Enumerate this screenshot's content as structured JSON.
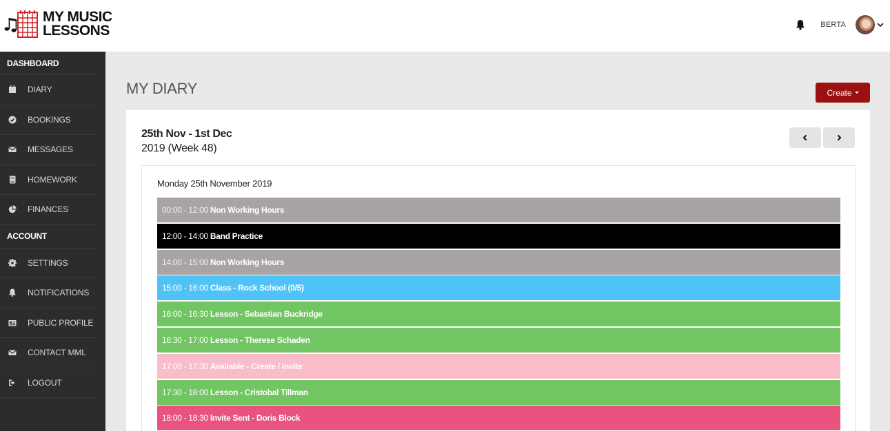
{
  "brand": {
    "line1": "MY MUSIC",
    "line2": "LESSONS"
  },
  "header": {
    "username": "BERTA"
  },
  "sidebar": {
    "dashboard_label": "DASHBOARD",
    "dashboard_items": [
      {
        "label": "DIARY",
        "icon": "calendar-icon"
      },
      {
        "label": "BOOKINGS",
        "icon": "check-circle-icon"
      },
      {
        "label": "MESSAGES",
        "icon": "envelope-icon"
      },
      {
        "label": "HOMEWORK",
        "icon": "book-icon"
      },
      {
        "label": "FINANCES",
        "icon": "pie-chart-icon"
      }
    ],
    "account_label": "ACCOUNT",
    "account_items": [
      {
        "label": "SETTINGS",
        "icon": "gear-icon"
      },
      {
        "label": "NOTIFICATIONS",
        "icon": "bell-icon"
      },
      {
        "label": "PUBLIC PROFILE",
        "icon": "id-card-icon"
      },
      {
        "label": "CONTACT MML",
        "icon": "envelope-icon"
      },
      {
        "label": "LOGOUT",
        "icon": "sign-out-icon"
      }
    ]
  },
  "main": {
    "title": "MY DIARY",
    "create_label": "Create",
    "week_range": "25th Nov - 1st Dec",
    "week_number": "2019 (Week 48)",
    "day_title": "Monday 25th November 2019",
    "events": [
      {
        "time": "00:00 - 12:00",
        "label": "Non Working Hours",
        "bg": "#a8a4a5",
        "time_color": "#eeeeee",
        "label_color": "#ffffff"
      },
      {
        "time": "12:00 - 14:00",
        "label": "Band Practice",
        "bg": "#000000",
        "time_color": "#ffffff",
        "label_color": "#ffffff"
      },
      {
        "time": "14:00 - 15:00",
        "label": "Non Working Hours",
        "bg": "#a8a4a5",
        "time_color": "#eeeeee",
        "label_color": "#ffffff"
      },
      {
        "time": "15:00 - 16:00",
        "label": "Class - Rock School (0/5)",
        "bg": "#4fc3f7",
        "time_color": "#ffffff",
        "label_color": "#ffffff"
      },
      {
        "time": "16:00 - 16:30",
        "label": "Lesson - Sebastian Buckridge",
        "bg": "#71c562",
        "time_color": "#ffffff",
        "label_color": "#ffffff"
      },
      {
        "time": "16:30 - 17:00",
        "label": "Lesson - Therese Schaden",
        "bg": "#71c562",
        "time_color": "#ffffff",
        "label_color": "#ffffff"
      },
      {
        "time": "17:00 - 17:30",
        "label": "Available - Create / Invite",
        "bg": "#fbbcc9",
        "time_color": "#ffffff",
        "label_color": "#ffffff"
      },
      {
        "time": "17:30 - 18:00",
        "label": "Lesson - Cristobal Tillman",
        "bg": "#71c562",
        "time_color": "#ffffff",
        "label_color": "#ffffff"
      },
      {
        "time": "18:00 - 18:30",
        "label": "Invite Sent - Doris Block",
        "bg": "#e8537f",
        "time_color": "#ffffff",
        "label_color": "#ffffff"
      }
    ]
  }
}
